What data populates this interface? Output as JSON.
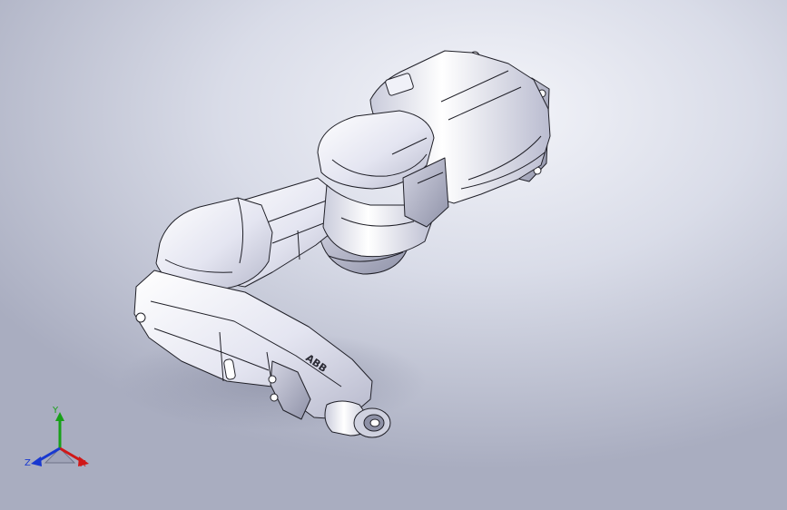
{
  "viewport": {
    "background_top": "#f4f5fa",
    "background_bottom": "#a9adc0",
    "model": {
      "description_icon": "robot-arm-model",
      "body_color": "#e6e7f2",
      "edge_color": "#202028",
      "brand_text": "ABB"
    },
    "triad": {
      "x_label": "X",
      "y_label": "Y",
      "z_label": "Z",
      "x_color": "#d01818",
      "y_color": "#18a018",
      "z_color": "#1838d0"
    }
  }
}
